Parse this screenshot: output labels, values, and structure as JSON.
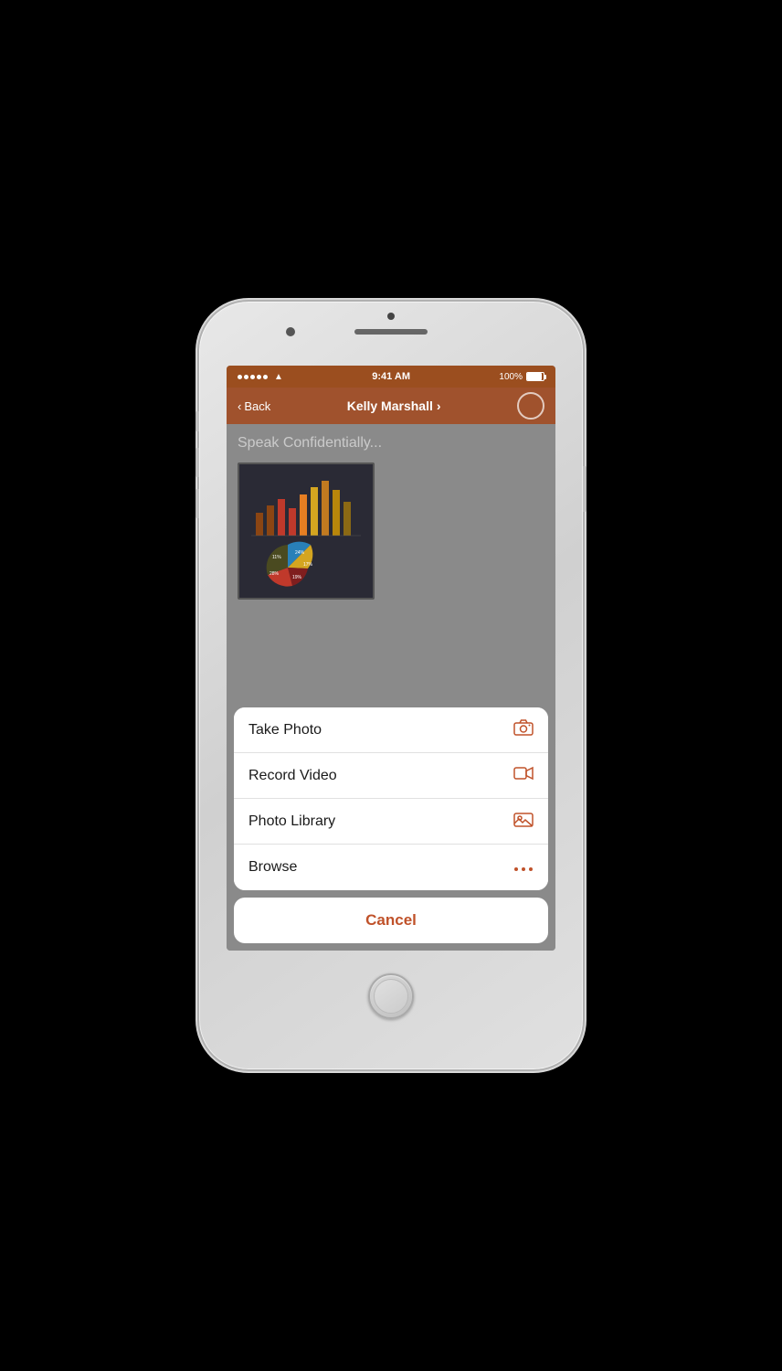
{
  "phone": {
    "status_bar": {
      "time": "9:41 AM",
      "battery": "100%"
    },
    "nav": {
      "back_label": "Back",
      "title": "Kelly Marshall",
      "chevron": "›"
    },
    "content": {
      "placeholder": "Speak Confidentially..."
    },
    "action_sheet": {
      "items": [
        {
          "label": "Take Photo",
          "icon": "camera"
        },
        {
          "label": "Record Video",
          "icon": "video"
        },
        {
          "label": "Photo Library",
          "icon": "photo"
        },
        {
          "label": "Browse",
          "icon": "more"
        }
      ],
      "cancel_label": "Cancel"
    }
  }
}
